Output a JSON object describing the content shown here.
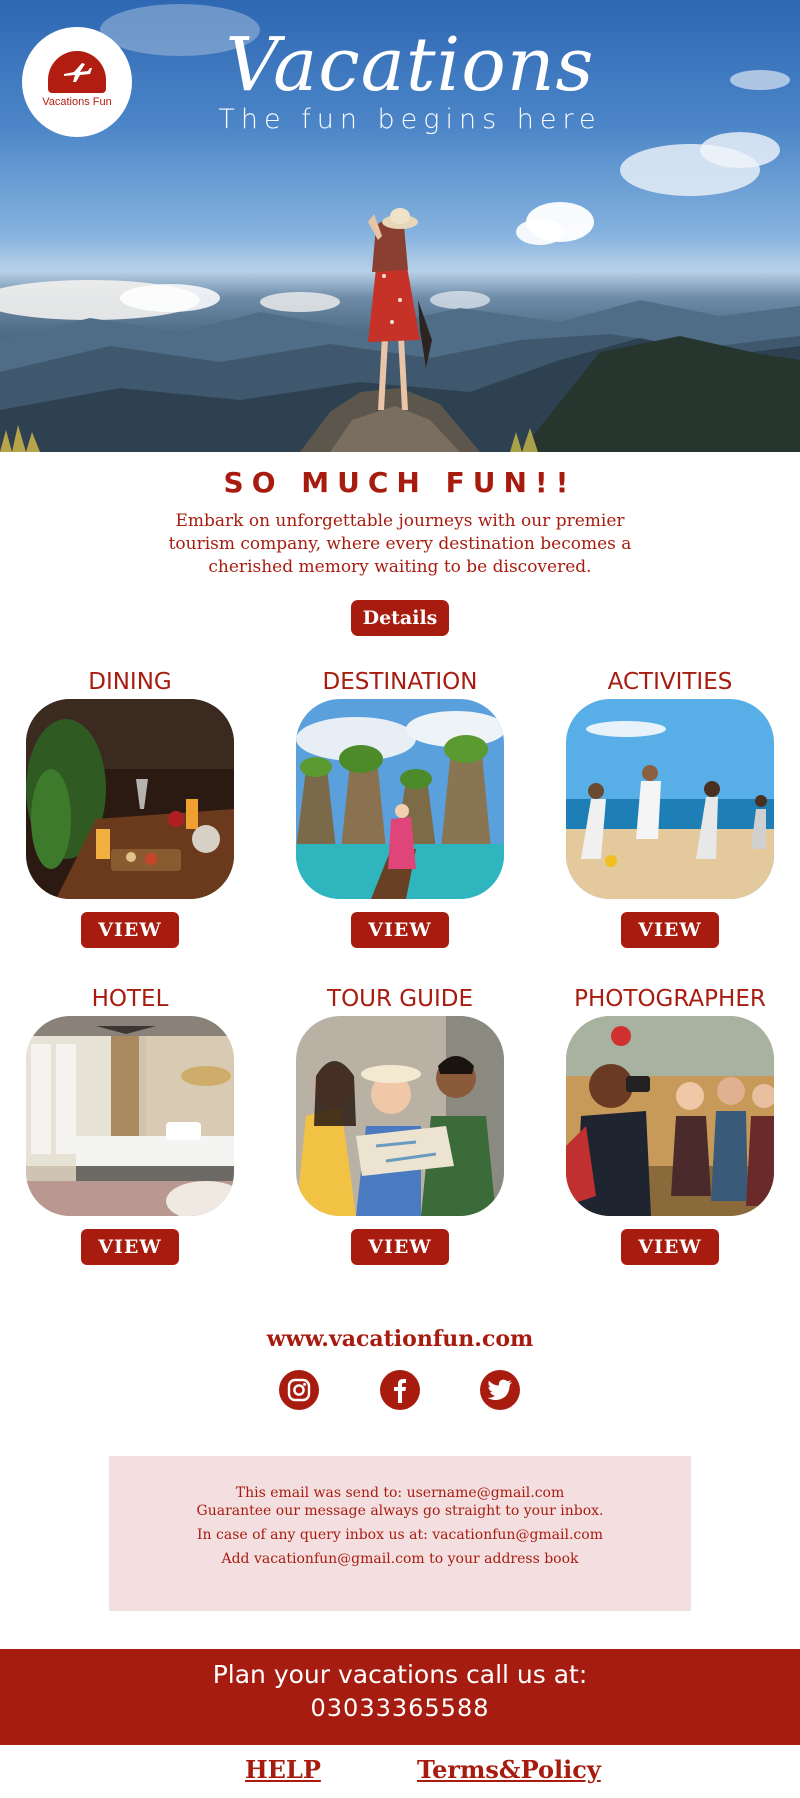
{
  "hero": {
    "logo_text": "Vacations Fun",
    "title": "Vacations",
    "subtitle": "The fun begins here"
  },
  "intro": {
    "headline": "SO MUCH FUN!!",
    "body": "Embark on unforgettable journeys with our premier tourism company, where every destination becomes a cherished memory waiting to be discovered.",
    "button_label": "Details"
  },
  "categories": [
    {
      "title": "DINING",
      "button_label": "VIEW"
    },
    {
      "title": "DESTINATION",
      "button_label": "VIEW"
    },
    {
      "title": "ACTIVITIES",
      "button_label": "VIEW"
    },
    {
      "title": "HOTEL",
      "button_label": "VIEW"
    },
    {
      "title": "TOUR GUIDE",
      "button_label": "VIEW"
    },
    {
      "title": "PHOTOGRAPHER",
      "button_label": "VIEW"
    }
  ],
  "footer": {
    "website": "www.vacationfun.com",
    "social_icons": [
      "instagram-icon",
      "facebook-icon",
      "twitter-icon"
    ],
    "notice": [
      "This email was send to: username@gmail.com",
      "Guarantee our message always go straight to your inbox.",
      "In case of any query inbox us at: vacationfun@gmail.com",
      "Add vacationfun@gmail.com to your address book"
    ],
    "cta_line1": "Plan your vacations call us at:",
    "cta_phone": "03033365588",
    "help_label": "HELP",
    "terms_label": "Terms&Policy"
  },
  "colors": {
    "brand": "#a81c10",
    "notice_bg": "#f4dfe0"
  }
}
